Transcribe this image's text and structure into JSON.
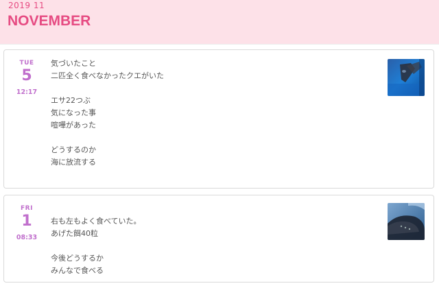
{
  "header": {
    "year_month": "2019 11",
    "month_name": "NOVEMBER"
  },
  "entries": [
    {
      "weekday": "TUE",
      "day": "5",
      "time": "12:17",
      "lines": [
        "気づいたこと",
        "二匹全く食べなかったクエがいた",
        "",
        "エサ22つぶ",
        "気になった事",
        "喧嘩があった",
        "",
        "どうするのか",
        "海に放流する"
      ],
      "thumbnail_icon": "fish-photo-thumbnail"
    },
    {
      "weekday": "FRI",
      "day": "1",
      "time": "08:33",
      "lines": [
        "右も左もよく食べていた。",
        "あげた餌40粒",
        "",
        "今後どうするか",
        "みんなで食べる"
      ],
      "thumbnail_icon": "fish-photo-thumbnail"
    }
  ],
  "colors": {
    "header_bg": "#fde1e8",
    "header_text": "#e64b82",
    "date_accent": "#c06fcc",
    "body_text": "#555555"
  }
}
